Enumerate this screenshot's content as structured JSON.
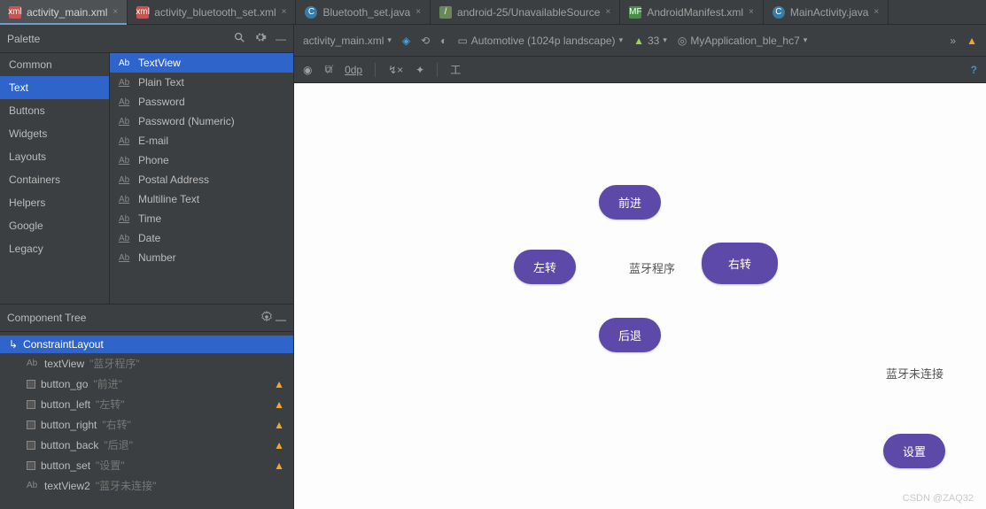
{
  "tabs": [
    {
      "label": "activity_main.xml",
      "icon": "xml",
      "active": true
    },
    {
      "label": "activity_bluetooth_set.xml",
      "icon": "xml"
    },
    {
      "label": "Bluetooth_set.java",
      "icon": "java"
    },
    {
      "label": "android-25/UnavailableSource",
      "icon": "diff"
    },
    {
      "label": "AndroidManifest.xml",
      "icon": "manifest"
    },
    {
      "label": "MainActivity.java",
      "icon": "java"
    }
  ],
  "palette": {
    "title": "Palette",
    "categories": [
      "Common",
      "Text",
      "Buttons",
      "Widgets",
      "Layouts",
      "Containers",
      "Helpers",
      "Google",
      "Legacy"
    ],
    "selected_category": "Text",
    "widgets": [
      "TextView",
      "Plain Text",
      "Password",
      "Password (Numeric)",
      "E-mail",
      "Phone",
      "Postal Address",
      "Multiline Text",
      "Time",
      "Date",
      "Number"
    ],
    "selected_widget": "TextView"
  },
  "component_tree": {
    "title": "Component Tree",
    "root": "ConstraintLayout",
    "children": [
      {
        "icon": "Ab",
        "name": "textView",
        "text": "\"蓝牙程序\"",
        "warn": false
      },
      {
        "icon": "box",
        "name": "button_go",
        "text": "\"前进\"",
        "warn": true
      },
      {
        "icon": "box",
        "name": "button_left",
        "text": "\"左转\"",
        "warn": true
      },
      {
        "icon": "box",
        "name": "button_right",
        "text": "\"右转\"",
        "warn": true
      },
      {
        "icon": "box",
        "name": "button_back",
        "text": "\"后退\"",
        "warn": true
      },
      {
        "icon": "box",
        "name": "button_set",
        "text": "\"设置\"",
        "warn": true
      },
      {
        "icon": "Ab",
        "name": "textView2",
        "text": "\"蓝牙未连接\"",
        "warn": false
      }
    ]
  },
  "design_toolbar": {
    "file": "activity_main.xml",
    "device": "Automotive (1024p landscape)",
    "api": "33",
    "theme": "MyApplication_ble_hc7",
    "zoom": "0dp"
  },
  "preview": {
    "buttons": {
      "go": "前进",
      "left": "左转",
      "right": "右转",
      "back": "后退",
      "set": "设置"
    },
    "label_center": "蓝牙程序",
    "label_status": "蓝牙未连接",
    "watermark": "CSDN @ZAQ32"
  }
}
